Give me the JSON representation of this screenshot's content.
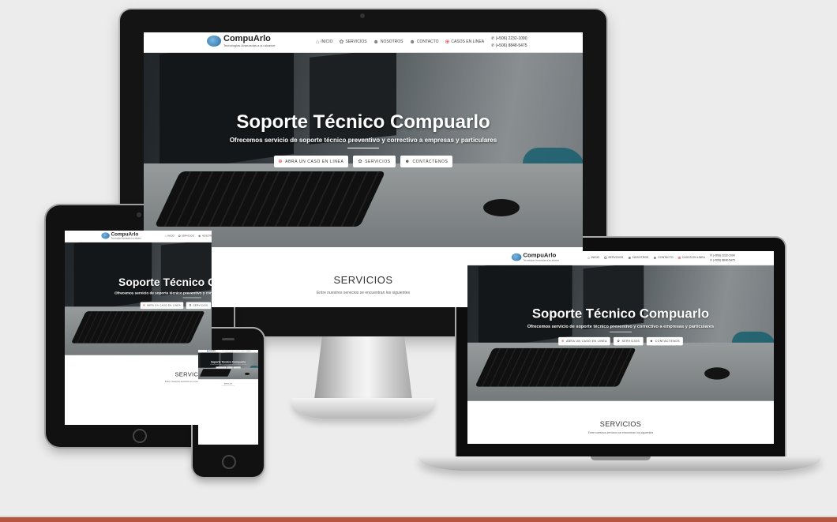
{
  "site": {
    "brand": "CompuArlo",
    "tagline": "Tecnologías Avanzadas a su alcance",
    "nav": [
      {
        "label": "INICIO",
        "icon": "home-icon"
      },
      {
        "label": "SERVICIOS",
        "icon": "gear-icon"
      },
      {
        "label": "NOSOTROS",
        "icon": "users-icon"
      },
      {
        "label": "CONTACTO",
        "icon": "users-icon"
      },
      {
        "label": "CASOS EN LINEA",
        "icon": "lifebuoy-icon"
      }
    ],
    "phones": [
      "(+506) 2232-1090",
      "(+506) 8848-5475"
    ],
    "hero": {
      "title": "Soporte Técnico Compuarlo",
      "subtitle": "Ofrecemos servicio de soporte técnico preventivo y correctivo a empresas y particulares",
      "buttons": [
        {
          "label": "ABRA UN CASO EN LINEA",
          "icon": "lifebuoy-icon"
        },
        {
          "label": "SERVICIOS",
          "icon": "gear-icon"
        },
        {
          "label": "CONTÁCTENOS",
          "icon": "users-icon"
        }
      ]
    },
    "services": {
      "title": "SERVICIOS",
      "text": "Entre nuestros servicios se encuentran los siguientes"
    }
  },
  "colors": {
    "background": "#ececec",
    "accent_bar": "#b5553d",
    "lifebuoy": "#dd3333"
  }
}
